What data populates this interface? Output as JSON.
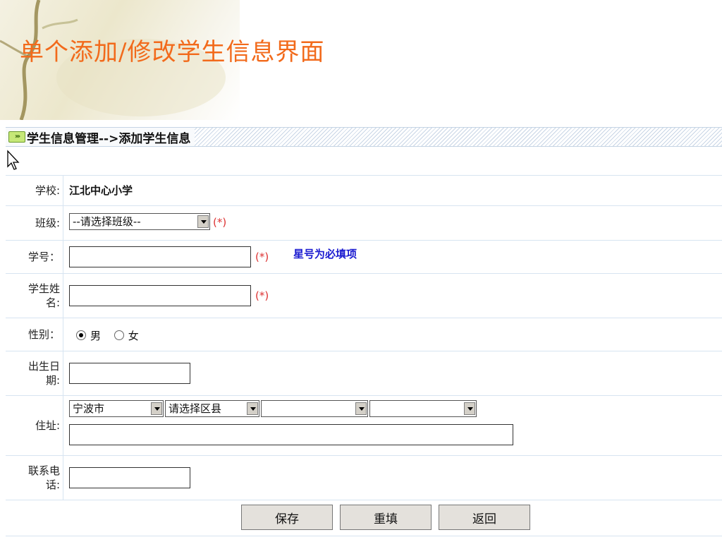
{
  "slide": {
    "title": "单个添加/修改学生信息界面"
  },
  "header": {
    "icon": "double-arrow-icon",
    "breadcrumb": "学生信息管理-->添加学生信息"
  },
  "form": {
    "school": {
      "label": "学校:",
      "value": "江北中心小学"
    },
    "class": {
      "label": "班级:",
      "selected": "--请选择班级--",
      "required": "(*)"
    },
    "student_id": {
      "label": "学号：",
      "value": "",
      "required": "(*)",
      "note": "星号为必填项"
    },
    "student_name": {
      "label": "学生姓名:",
      "value": "",
      "required": "(*)"
    },
    "gender": {
      "label": "性别：",
      "options": [
        "男",
        "女"
      ],
      "selected": "男"
    },
    "birthdate": {
      "label": "出生日期:",
      "value": ""
    },
    "address": {
      "label": "住址:",
      "city": "宁波市",
      "district": "请选择区县",
      "street": "",
      "community": "",
      "detail": ""
    },
    "phone": {
      "label": "联系电话:",
      "value": ""
    }
  },
  "buttons": {
    "save": "保存",
    "reset": "重填",
    "back": "返回"
  },
  "colors": {
    "title": "#f26a1b",
    "note": "#1a1ad0",
    "required_star": "#d33333",
    "border": "#d7e4f1"
  }
}
